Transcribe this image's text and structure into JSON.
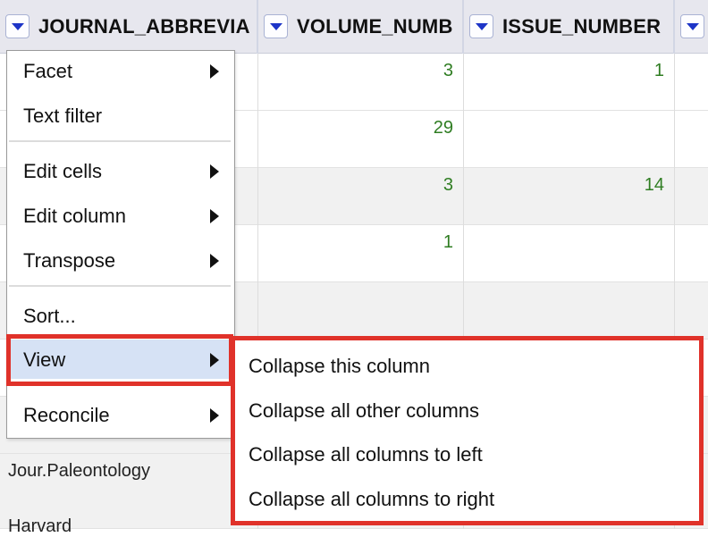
{
  "columns": [
    {
      "name": "JOURNAL_ABBREVIA"
    },
    {
      "name": "VOLUME_NUMB"
    },
    {
      "name": "ISSUE_NUMBER"
    },
    {
      "name": ""
    }
  ],
  "rows": [
    {
      "journal": "",
      "volume": "3",
      "issue": "1"
    },
    {
      "journal": "",
      "volume": "29",
      "issue": ""
    },
    {
      "journal": "",
      "volume": "3",
      "issue": "14"
    },
    {
      "journal": "",
      "volume": "1",
      "issue": ""
    },
    {
      "journal": "",
      "volume": "",
      "issue": ""
    },
    {
      "journal": "",
      "volume": "",
      "issue": ""
    },
    {
      "journal": "Jour.Paleontology",
      "volume": "",
      "issue": ""
    },
    {
      "journal": "Harvard",
      "volume": "",
      "issue": ""
    }
  ],
  "column_menu": {
    "items": [
      {
        "label": "Facet",
        "has_submenu": true
      },
      {
        "label": "Text filter",
        "has_submenu": false
      },
      {
        "label": "Edit cells",
        "has_submenu": true
      },
      {
        "label": "Edit column",
        "has_submenu": true
      },
      {
        "label": "Transpose",
        "has_submenu": true
      },
      {
        "label": "Sort...",
        "has_submenu": false
      },
      {
        "label": "View",
        "has_submenu": true,
        "active": true
      },
      {
        "label": "Reconcile",
        "has_submenu": true
      }
    ]
  },
  "view_submenu": {
    "items": [
      {
        "label": "Collapse this column"
      },
      {
        "label": "Collapse all other columns"
      },
      {
        "label": "Collapse all columns to left"
      },
      {
        "label": "Collapse all columns to right"
      }
    ]
  },
  "colors": {
    "accent_highlight": "#e0322a",
    "number_text": "#2f7d22",
    "dropdown_arrow": "#1d34c7",
    "active_item_bg": "#d6e2f5"
  }
}
